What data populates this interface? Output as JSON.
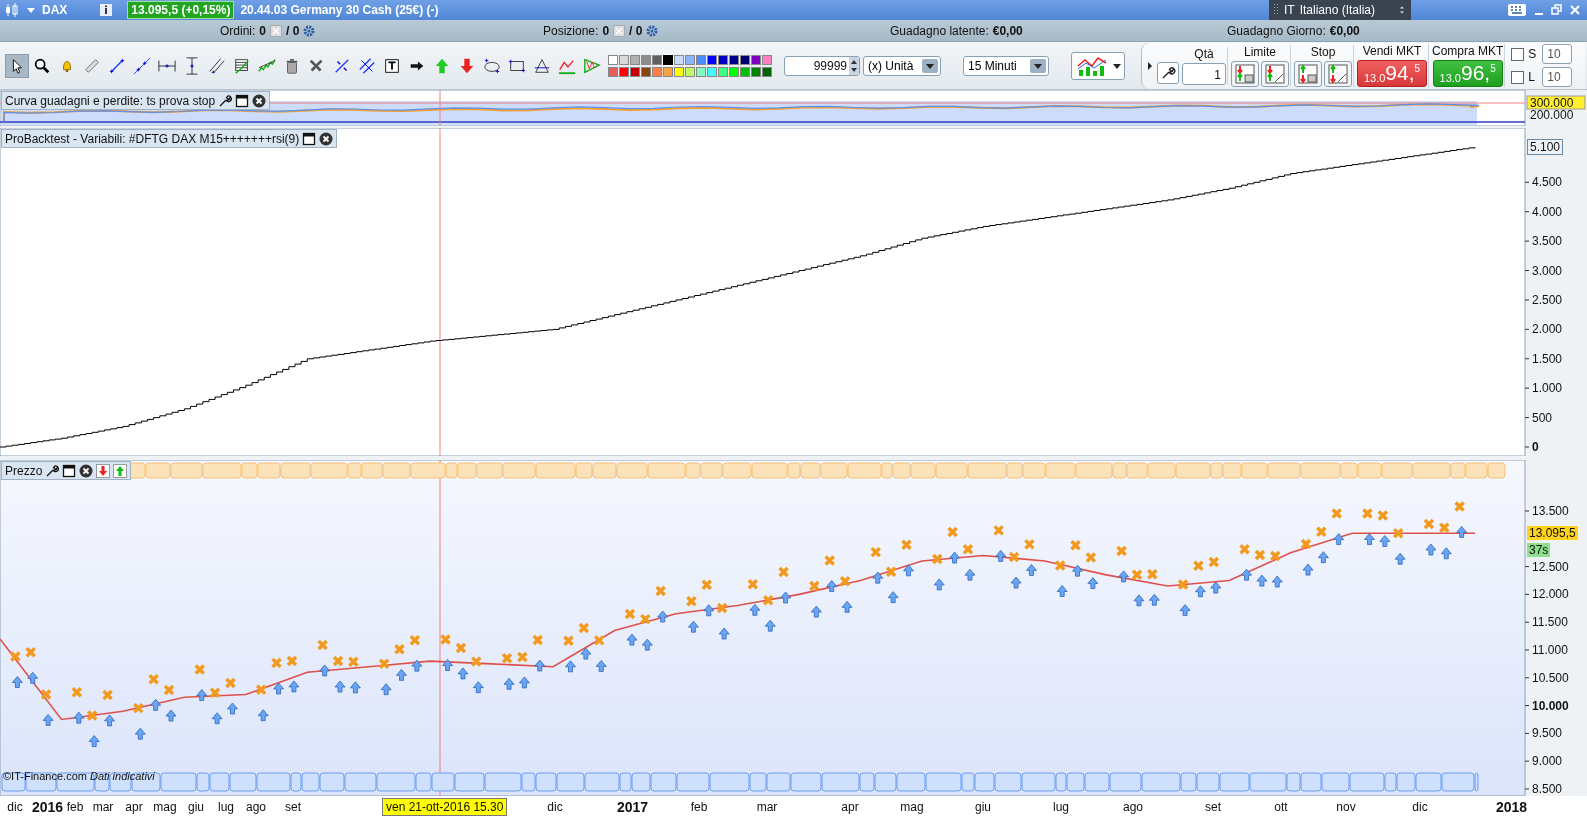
{
  "title_bar": {
    "symbol": "DAX",
    "price_badge": "13.095,5 (+0,15%)",
    "description": "20.44.03 Germany 30 Cash (25€) (-)",
    "language": {
      "code": "IT",
      "name": "Italiano (Italia)"
    }
  },
  "info_bar": [
    {
      "kind": "count",
      "label": "Ordini:",
      "value": "0",
      "total": "/ 0"
    },
    {
      "kind": "count",
      "label": "Posizione:",
      "value": "0",
      "total": "/ 0"
    },
    {
      "kind": "amount",
      "label": "Guadagno latente:",
      "value": "€0,00"
    },
    {
      "kind": "amount",
      "label": "Guadagno Giorno:",
      "value": "€0,00"
    }
  ],
  "toolbar": {
    "tools": [
      {
        "selected": true
      },
      {
        "selected": false
      },
      {
        "selected": false
      },
      {
        "selected": false
      },
      {
        "selected": false
      },
      {
        "selected": false
      },
      {
        "selected": false
      },
      {
        "selected": false
      },
      {
        "selected": false
      },
      {
        "selected": false
      },
      {
        "selected": false
      },
      {
        "selected": false
      },
      {
        "selected": false
      },
      {
        "selected": false
      },
      {
        "selected": false
      },
      {
        "selected": false
      },
      {
        "selected": false
      },
      {
        "selected": false
      },
      {
        "selected": false
      },
      {
        "selected": false
      },
      {
        "selected": false
      },
      {
        "selected": false
      },
      {
        "selected": false
      },
      {
        "selected": false
      }
    ],
    "palette": [
      {
        "color": "#ffffff",
        "selected": false
      },
      {
        "color": "#d9d9d9",
        "selected": false
      },
      {
        "color": "#b0b0b0",
        "selected": false
      },
      {
        "color": "#8c8c8c",
        "selected": false
      },
      {
        "color": "#606060",
        "selected": false
      },
      {
        "color": "#000000",
        "selected": true
      },
      {
        "color": "#c8dcff",
        "selected": false
      },
      {
        "color": "#88b4ff",
        "selected": false
      },
      {
        "color": "#4a8cff",
        "selected": false
      },
      {
        "color": "#0000ff",
        "selected": false
      },
      {
        "color": "#0000c0",
        "selected": false
      },
      {
        "color": "#00008b",
        "selected": false
      },
      {
        "color": "#000070",
        "selected": false
      },
      {
        "color": "#8000c0",
        "selected": false
      },
      {
        "color": "#ff80c0",
        "selected": false
      },
      {
        "color": "#e06060",
        "selected": false
      },
      {
        "color": "#ff0000",
        "selected": false
      },
      {
        "color": "#c00000",
        "selected": false
      },
      {
        "color": "#8b4513",
        "selected": false
      },
      {
        "color": "#ff8040",
        "selected": false
      },
      {
        "color": "#ffa040",
        "selected": false
      },
      {
        "color": "#ffff00",
        "selected": false
      },
      {
        "color": "#c0ff60",
        "selected": false
      },
      {
        "color": "#80ffc0",
        "selected": false
      },
      {
        "color": "#40ffff",
        "selected": false
      },
      {
        "color": "#40ff80",
        "selected": false
      },
      {
        "color": "#00ff00",
        "selected": false
      },
      {
        "color": "#00c000",
        "selected": false
      },
      {
        "color": "#008000",
        "selected": false
      },
      {
        "color": "#006400",
        "selected": false
      }
    ],
    "quantity": "99999",
    "unit": "(x) Unità",
    "timeframe": "15 Minuti"
  },
  "order_panel": {
    "qty_label": "Qtà",
    "qty": "1",
    "limit_label": "Limite",
    "stop_label": "Stop",
    "sell": {
      "label": "Vendi MKT",
      "prefix": "13.0",
      "big": "94,",
      "sup": "5"
    },
    "buy": {
      "label": "Compra MKT",
      "prefix": "13.0",
      "big": "96,",
      "sup": "5"
    },
    "protections": [
      {
        "label": "S",
        "checked": false,
        "value": "10"
      },
      {
        "label": "L",
        "checked": false,
        "value": "10"
      }
    ]
  },
  "equity_panel": {
    "title": "Curva guadagni e perdite: ts prova stop",
    "axis": [
      {
        "label": "300.000",
        "highlighted": true
      },
      {
        "label": "200.000",
        "highlighted": false
      }
    ]
  },
  "backtest_panel": {
    "title": "ProBacktest - Variabili: #DFTG DAX M15+++++++rsi(9)",
    "last_value": "5.100",
    "chart_data": {
      "type": "line",
      "series": [
        {
          "color": "#000000",
          "values": [
            0,
            150,
            350,
            650,
            1050,
            1500,
            1650,
            1800,
            1900,
            2000,
            2250,
            2500,
            2750,
            3000,
            3250,
            3550,
            3750,
            3900,
            4050,
            4200,
            4400,
            4650,
            4800,
            4950,
            5100
          ]
        }
      ],
      "ylim": [
        -153,
        5423
      ],
      "yticks": [
        {
          "value": 0,
          "label": "0"
        },
        {
          "value": 500,
          "label": "500"
        },
        {
          "value": 1000,
          "label": "1.000"
        },
        {
          "value": 1500,
          "label": "1.500"
        },
        {
          "value": 2000,
          "label": "2.000"
        },
        {
          "value": 2500,
          "label": "2.500"
        },
        {
          "value": 3000,
          "label": "3.000"
        },
        {
          "value": 3500,
          "label": "3.500"
        },
        {
          "value": 4000,
          "label": "4.000"
        },
        {
          "value": 4500,
          "label": "4.500"
        }
      ]
    }
  },
  "price_panel": {
    "title": "Prezzo",
    "last_price": "13.095,5",
    "countdown": "37s",
    "copyright": "©IT-Finance.com *Dati indicativi*",
    "cursor_date": "ven 21-ott-2016 15.30",
    "time_axis": [
      {
        "label": "dic",
        "kind": "month"
      },
      {
        "label": "2016",
        "kind": "year"
      },
      {
        "label": "feb",
        "kind": "month"
      },
      {
        "label": "mar",
        "kind": "month"
      },
      {
        "label": "apr",
        "kind": "month"
      },
      {
        "label": "mag",
        "kind": "month"
      },
      {
        "label": "giu",
        "kind": "month"
      },
      {
        "label": "lug",
        "kind": "month"
      },
      {
        "label": "ago",
        "kind": "month"
      },
      {
        "label": "set",
        "kind": "month"
      },
      {
        "label": "dic",
        "kind": "month"
      },
      {
        "label": "2017",
        "kind": "year"
      },
      {
        "label": "feb",
        "kind": "month"
      },
      {
        "label": "mar",
        "kind": "month"
      },
      {
        "label": "apr",
        "kind": "month"
      },
      {
        "label": "mag",
        "kind": "month"
      },
      {
        "label": "giu",
        "kind": "month"
      },
      {
        "label": "lug",
        "kind": "month"
      },
      {
        "label": "ago",
        "kind": "month"
      },
      {
        "label": "set",
        "kind": "month"
      },
      {
        "label": "ott",
        "kind": "month"
      },
      {
        "label": "nov",
        "kind": "month"
      },
      {
        "label": "dic",
        "kind": "month"
      },
      {
        "label": "2018",
        "kind": "year"
      }
    ],
    "chart_data": {
      "type": "line",
      "series": [
        {
          "color": "#e0504a",
          "values": [
            11200,
            9750,
            9900,
            10150,
            10200,
            10600,
            10700,
            10800,
            10750,
            10700,
            11350,
            11650,
            11800,
            12000,
            12250,
            12600,
            12700,
            12600,
            12350,
            12150,
            12250,
            12750,
            13100,
            13100,
            13100
          ]
        }
      ],
      "ylim": [
        8374,
        14417
      ],
      "yticks": [
        {
          "value": 8500,
          "label": "8.500"
        },
        {
          "value": 9000,
          "label": "9.000"
        },
        {
          "value": 9500,
          "label": "9.500"
        },
        {
          "value": 10000,
          "label": "10.000"
        },
        {
          "value": 10500,
          "label": "10.500"
        },
        {
          "value": 11000,
          "label": "11.000"
        },
        {
          "value": 11500,
          "label": "11.500"
        },
        {
          "value": 12000,
          "label": "12.000"
        },
        {
          "value": 12500,
          "label": "12.500"
        },
        {
          "value": 13500,
          "label": "13.500"
        }
      ]
    }
  }
}
